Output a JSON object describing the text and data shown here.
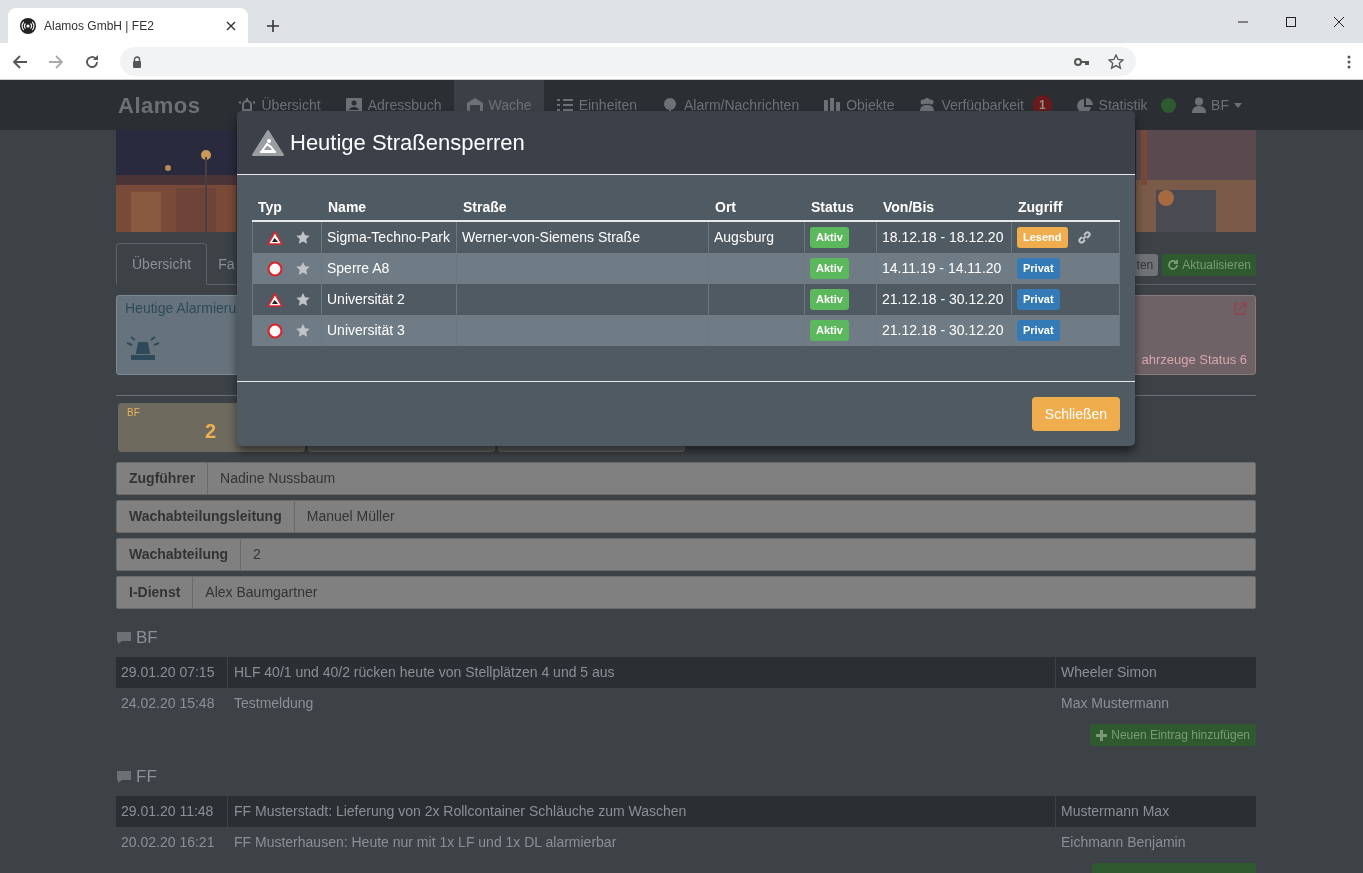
{
  "browser": {
    "tab_title": "Alamos GmbH | FE2"
  },
  "navbar": {
    "brand": "Alamos",
    "items": [
      {
        "label": "Übersicht",
        "selected": false
      },
      {
        "label": "Adressbuch",
        "selected": false
      },
      {
        "label": "Wache",
        "selected": true
      },
      {
        "label": "Einheiten",
        "selected": false
      },
      {
        "label": "Alarm/Nachrichten",
        "selected": false
      },
      {
        "label": "Objekte",
        "selected": false
      },
      {
        "label": "Verfügbarkeit",
        "selected": false,
        "badge": "1"
      },
      {
        "label": "Statistik",
        "selected": false
      }
    ],
    "user": "BF"
  },
  "page": {
    "tabs": [
      {
        "label": "Übersicht",
        "selected": true
      },
      {
        "label": "Fa",
        "selected": false
      }
    ],
    "toolbar_buttons": [
      {
        "label": "ten",
        "kind": "default"
      },
      {
        "label": "Aktualisieren",
        "kind": "refresh"
      }
    ],
    "cards": [
      {
        "title": "Heutige Alarmieru",
        "kind": "alarms"
      },
      {
        "footer": "ahrzeuge Status 6",
        "kind": "status"
      }
    ],
    "counters": [
      {
        "label": "BF",
        "value": "2"
      }
    ],
    "info_rows": [
      {
        "label": "Zugführer",
        "value": "Nadine Nussbaum"
      },
      {
        "label": "Wachabteilungsleitung",
        "value": "Manuel Müller"
      },
      {
        "label": "Wachabteilung",
        "value": "2"
      },
      {
        "label": "I-Dienst",
        "value": "Alex Baumgartner"
      }
    ],
    "sections": [
      {
        "title": "BF",
        "entries": [
          {
            "time": "29.01.20 07:15",
            "message": "HLF 40/1 und 40/2 rücken heute von Stellplätzen 4 und 5 aus",
            "author": "Wheeler Simon"
          },
          {
            "time": "24.02.20 15:48",
            "message": "Testmeldung",
            "author": "Max Mustermann"
          }
        ],
        "add_button": "Neuen Eintrag hinzufügen"
      },
      {
        "title": "FF",
        "entries": [
          {
            "time": "29.01.20 11:48",
            "message": "FF Musterstadt: Lieferung von 2x Rollcontainer Schläuche zum Waschen",
            "author": "Mustermann Max"
          },
          {
            "time": "20.02.20 16:21",
            "message": "FF Musterhausen: Heute nur mit 1x LF und 1x DL alarmierbar",
            "author": "Eichmann Benjamin"
          }
        ]
      }
    ]
  },
  "modal": {
    "title": "Heutige Straßensperren",
    "columns": [
      "Typ",
      "Name",
      "Straße",
      "Ort",
      "Status",
      "Von/Bis",
      "Zugriff"
    ],
    "rows": [
      {
        "kind": "construction",
        "name": "Sigma-Techno-Park",
        "street": "Werner-von-Siemens Straße",
        "city": "Augsburg",
        "status": "Aktiv",
        "period": "18.12.18 - 18.12.20",
        "access": {
          "label": "Lesend",
          "kind": "read"
        },
        "shared": true
      },
      {
        "kind": "closure",
        "name": "Sperre A8",
        "status": "Aktiv",
        "period": "14.11.19 - 14.11.20",
        "access": {
          "label": "Privat",
          "kind": "private"
        },
        "shared": false
      },
      {
        "kind": "construction",
        "name": "Universität 2",
        "status": "Aktiv",
        "period": "21.12.18 - 30.12.20",
        "access": {
          "label": "Privat",
          "kind": "private"
        },
        "shared": false
      },
      {
        "kind": "closure",
        "name": "Universität 3",
        "status": "Aktiv",
        "period": "21.12.18 - 30.12.20",
        "access": {
          "label": "Privat",
          "kind": "private"
        },
        "shared": false
      }
    ],
    "close_button": "Schließen"
  }
}
